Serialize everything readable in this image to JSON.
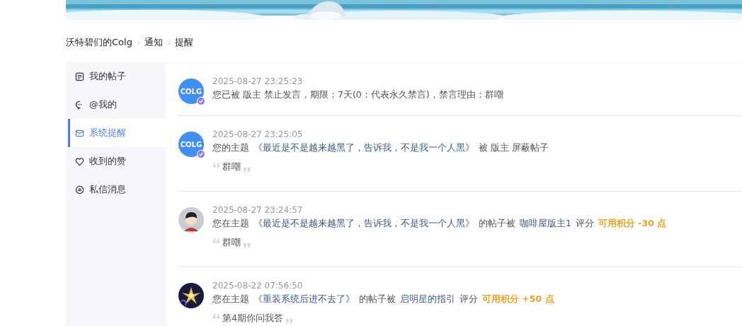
{
  "breadcrumb": [
    {
      "label": "沃特碧们的Colg"
    },
    {
      "label": "通知"
    },
    {
      "label": "提醒"
    }
  ],
  "sidebar": {
    "items": [
      {
        "label": "我的帖子",
        "selected": false
      },
      {
        "label": "@我的",
        "selected": false
      },
      {
        "label": "系统提醒",
        "selected": true
      },
      {
        "label": "收到的赞",
        "selected": false
      },
      {
        "label": "私信消息",
        "selected": false
      }
    ]
  },
  "notifications": [
    {
      "avatar": {
        "kind": "logo",
        "text": "COLG",
        "verified": true
      },
      "time": "2025-08-27 23:25:23",
      "segments": [
        {
          "kind": "text",
          "text": "您已被 版主 禁止发言，期限：7天(0：代表永久禁言)，禁言理由：群嘲"
        }
      ]
    },
    {
      "avatar": {
        "kind": "logo",
        "text": "COLG",
        "verified": true
      },
      "time": "2025-08-27 23:25:05",
      "segments": [
        {
          "kind": "text",
          "text": "您的主题"
        },
        {
          "kind": "link",
          "text": "《最近是不是越来越黑了，告诉我，不是我一个人黑》"
        },
        {
          "kind": "text",
          "text": "被 版主 屏蔽帖子"
        }
      ],
      "quote": "群嘲"
    },
    {
      "avatar": {
        "kind": "person",
        "verified": false
      },
      "time": "2025-08-27 23:24:57",
      "segments": [
        {
          "kind": "text",
          "text": "您在主题"
        },
        {
          "kind": "link",
          "text": "《最近是不是越来越黑了，告诉我，不是我一个人黑》"
        },
        {
          "kind": "text",
          "text": "的帖子被"
        },
        {
          "kind": "link",
          "text": "咖啡屋版主1"
        },
        {
          "kind": "text",
          "text": "评分"
        },
        {
          "kind": "points",
          "text": "可用积分 -30 点"
        }
      ],
      "quote": "群嘲"
    },
    {
      "time": "2025-08-22 07:56:50",
      "segments": [
        {
          "kind": "text",
          "text": "您在主题"
        },
        {
          "kind": "link",
          "text": "《重装系统后进不去了》"
        },
        {
          "kind": "text",
          "text": "的帖子被"
        },
        {
          "kind": "link",
          "text": "启明星的指引"
        },
        {
          "kind": "text",
          "text": "评分"
        },
        {
          "kind": "points",
          "text": "可用积分 +50 点"
        }
      ],
      "quote": "第4期你问我答"
    }
  ]
}
